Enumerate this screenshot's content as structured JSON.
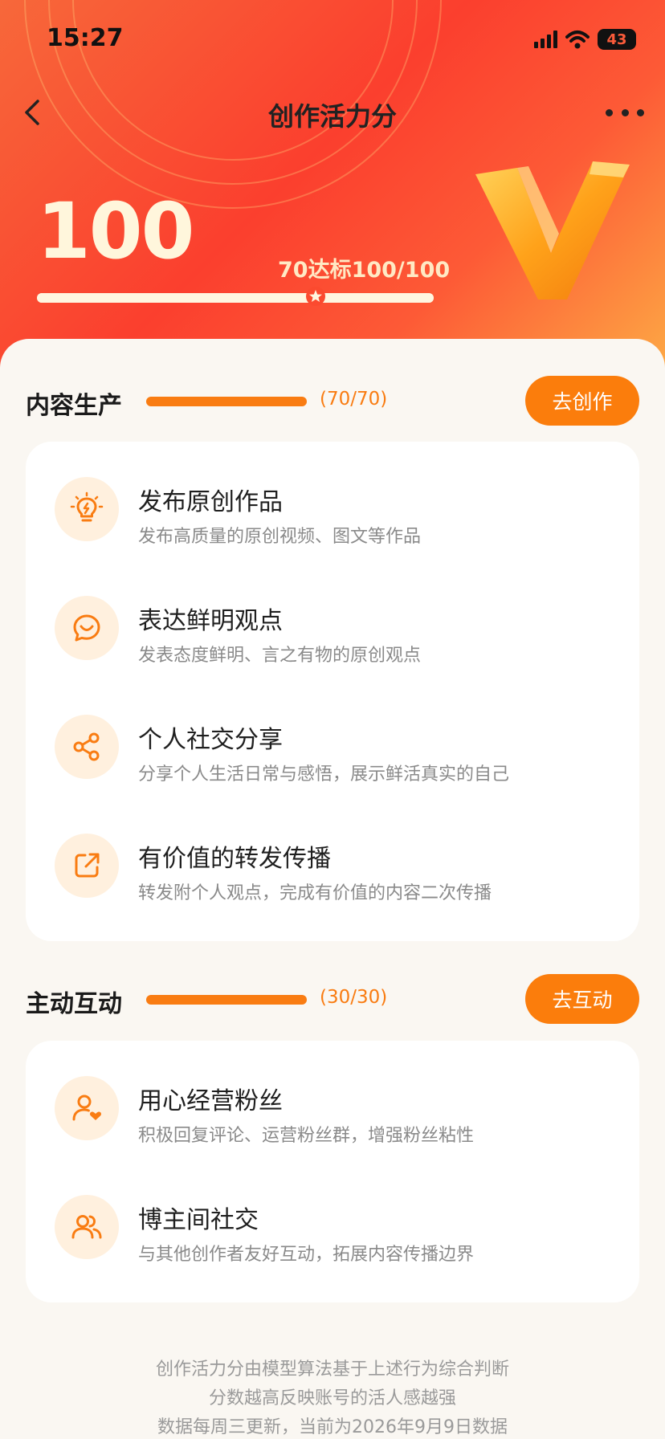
{
  "status_bar": {
    "time": "15:27",
    "battery": "43"
  },
  "nav": {
    "title": "创作活力分"
  },
  "score": {
    "value": "100",
    "standard_label": "70达标100/100",
    "progress_fraction": 1.0
  },
  "sections": [
    {
      "title": "内容生产",
      "score": "(70/70)",
      "progress_fraction": 1.0,
      "button_label": "去创作",
      "items": [
        {
          "title": "发布原创作品",
          "desc": "发布高质量的原创视频、图文等作品",
          "icon": "lightbulb-icon"
        },
        {
          "title": "表达鲜明观点",
          "desc": "发表态度鲜明、言之有物的原创观点",
          "icon": "chat-smile-icon"
        },
        {
          "title": "个人社交分享",
          "desc": "分享个人生活日常与感悟，展示鲜活真实的自己",
          "icon": "share-icon"
        },
        {
          "title": "有价值的转发传播",
          "desc": "转发附个人观点，完成有价值的内容二次传播",
          "icon": "forward-icon"
        }
      ]
    },
    {
      "title": "主动互动",
      "score": "(30/30)",
      "progress_fraction": 1.0,
      "button_label": "去互动",
      "items": [
        {
          "title": "用心经营粉丝",
          "desc": "积极回复评论、运营粉丝群，增强粉丝粘性",
          "icon": "user-heart-icon"
        },
        {
          "title": "博主间社交",
          "desc": "与其他创作者友好互动，拓展内容传播边界",
          "icon": "users-icon"
        }
      ]
    }
  ],
  "footer": {
    "line1": "创作活力分由模型算法基于上述行为综合判断",
    "line2": "分数越高反映账号的活人感越强",
    "line3": "数据每周三更新，当前为2026年9月9日数据"
  },
  "colors": {
    "accent": "#fb7d0c",
    "hero_red": "#fb3f2e",
    "icon_bg": "#fff0de"
  }
}
